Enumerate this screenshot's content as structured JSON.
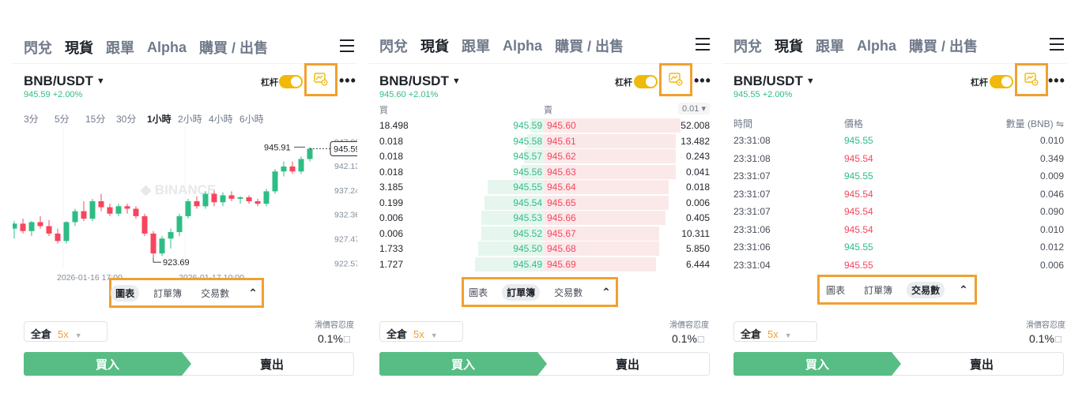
{
  "nav": {
    "items": [
      "閃兌",
      "現貨",
      "跟單",
      "Alpha",
      "購買 / 出售"
    ],
    "active": 1
  },
  "header": {
    "pair": "BNB/USDT",
    "caret": "▼",
    "leverage_label": "杠杆",
    "more": "•••"
  },
  "panels": [
    {
      "price": "945.59",
      "change": "+2.00%"
    },
    {
      "price": "945.60",
      "change": "+2.01%"
    },
    {
      "price": "945.55",
      "change": "+2.00%"
    }
  ],
  "tabs": {
    "chart": "圖表",
    "orderbook": "訂單簿",
    "trades": "交易數",
    "collapse": "⌃"
  },
  "timeframes": [
    "3分",
    "5分",
    "15分",
    "30分",
    "1小時",
    "2小時",
    "4小時",
    "6小時"
  ],
  "timeframe_active": 4,
  "chart_data": {
    "type": "candlestick",
    "y_ticks": [
      "947.03",
      "945.59",
      "942.13",
      "937.24",
      "932.36",
      "927.47",
      "922.57"
    ],
    "x_ticks": [
      "2026-01-16 17:00",
      "2026-01-17 10:00"
    ],
    "high_label": "945.91",
    "low_label": "923.69",
    "current_label": "945.59",
    "ylim": [
      921.5,
      948.5
    ],
    "candles": [
      {
        "o": 929.5,
        "h": 931.0,
        "l": 927.5,
        "c": 930.5
      },
      {
        "o": 930.5,
        "h": 931.5,
        "l": 928.5,
        "c": 929.0
      },
      {
        "o": 929.0,
        "h": 931.0,
        "l": 928.0,
        "c": 930.8
      },
      {
        "o": 930.8,
        "h": 932.0,
        "l": 929.5,
        "c": 930.0
      },
      {
        "o": 930.0,
        "h": 931.2,
        "l": 928.0,
        "c": 928.5
      },
      {
        "o": 928.5,
        "h": 929.5,
        "l": 926.5,
        "c": 927.0
      },
      {
        "o": 927.0,
        "h": 931.0,
        "l": 926.5,
        "c": 930.8
      },
      {
        "o": 930.8,
        "h": 933.5,
        "l": 930.0,
        "c": 933.0
      },
      {
        "o": 933.0,
        "h": 935.0,
        "l": 931.0,
        "c": 931.5
      },
      {
        "o": 931.5,
        "h": 935.5,
        "l": 931.0,
        "c": 935.0
      },
      {
        "o": 935.0,
        "h": 936.5,
        "l": 933.0,
        "c": 933.8
      },
      {
        "o": 933.8,
        "h": 934.5,
        "l": 932.0,
        "c": 932.5
      },
      {
        "o": 932.5,
        "h": 934.5,
        "l": 932.0,
        "c": 934.0
      },
      {
        "o": 934.0,
        "h": 934.5,
        "l": 932.5,
        "c": 933.5
      },
      {
        "o": 933.5,
        "h": 934.0,
        "l": 931.5,
        "c": 932.0
      },
      {
        "o": 932.0,
        "h": 932.5,
        "l": 928.0,
        "c": 928.5
      },
      {
        "o": 928.5,
        "h": 929.0,
        "l": 923.69,
        "c": 924.5
      },
      {
        "o": 924.5,
        "h": 928.0,
        "l": 924.0,
        "c": 927.5
      },
      {
        "o": 927.5,
        "h": 929.5,
        "l": 925.5,
        "c": 928.8
      },
      {
        "o": 928.8,
        "h": 932.5,
        "l": 928.0,
        "c": 932.0
      },
      {
        "o": 932.0,
        "h": 935.5,
        "l": 931.5,
        "c": 935.0
      },
      {
        "o": 935.0,
        "h": 936.0,
        "l": 933.5,
        "c": 934.0
      },
      {
        "o": 934.0,
        "h": 937.0,
        "l": 933.5,
        "c": 936.5
      },
      {
        "o": 936.5,
        "h": 937.2,
        "l": 934.0,
        "c": 934.8
      },
      {
        "o": 934.8,
        "h": 936.8,
        "l": 934.0,
        "c": 936.2
      },
      {
        "o": 936.2,
        "h": 937.0,
        "l": 935.0,
        "c": 935.5
      },
      {
        "o": 935.5,
        "h": 936.0,
        "l": 934.5,
        "c": 935.8
      },
      {
        "o": 935.8,
        "h": 936.2,
        "l": 934.5,
        "c": 935.0
      },
      {
        "o": 935.0,
        "h": 935.5,
        "l": 934.0,
        "c": 934.5
      },
      {
        "o": 934.5,
        "h": 937.5,
        "l": 934.0,
        "c": 937.0
      },
      {
        "o": 937.0,
        "h": 941.5,
        "l": 936.5,
        "c": 941.0
      },
      {
        "o": 941.0,
        "h": 943.0,
        "l": 940.0,
        "c": 942.0
      },
      {
        "o": 942.0,
        "h": 943.0,
        "l": 940.5,
        "c": 941.0
      },
      {
        "o": 941.0,
        "h": 944.0,
        "l": 940.5,
        "c": 943.5
      },
      {
        "o": 943.5,
        "h": 945.91,
        "l": 943.0,
        "c": 945.59
      }
    ]
  },
  "orderbook": {
    "buy_label": "買",
    "sell_label": "賣",
    "precision": "0.01 ▾",
    "rows": [
      {
        "bq": "18.498",
        "bp": "945.59",
        "sp": "945.60",
        "sq": "52.008",
        "bd": 0.08,
        "sd": 0.7
      },
      {
        "bq": "0.018",
        "bp": "945.58",
        "sp": "945.61",
        "sq": "13.482",
        "bd": 0.1,
        "sd": 0.73
      },
      {
        "bq": "0.018",
        "bp": "945.57",
        "sp": "945.62",
        "sq": "0.243",
        "bd": 0.12,
        "sd": 0.73
      },
      {
        "bq": "0.018",
        "bp": "945.56",
        "sp": "945.63",
        "sq": "0.041",
        "bd": 0.14,
        "sd": 0.73
      },
      {
        "bq": "3.185",
        "bp": "945.55",
        "sp": "945.64",
        "sq": "0.018",
        "bd": 0.34,
        "sd": 0.77
      },
      {
        "bq": "0.199",
        "bp": "945.54",
        "sp": "945.65",
        "sq": "0.006",
        "bd": 0.36,
        "sd": 0.77
      },
      {
        "bq": "0.006",
        "bp": "945.53",
        "sp": "945.66",
        "sq": "0.405",
        "bd": 0.38,
        "sd": 0.79
      },
      {
        "bq": "0.006",
        "bp": "945.52",
        "sp": "945.67",
        "sq": "10.311",
        "bd": 0.38,
        "sd": 0.83
      },
      {
        "bq": "1.733",
        "bp": "945.50",
        "sp": "945.68",
        "sq": "5.850",
        "bd": 0.4,
        "sd": 0.83
      },
      {
        "bq": "1.727",
        "bp": "945.49",
        "sp": "945.69",
        "sq": "6.444",
        "bd": 0.42,
        "sd": 0.85
      }
    ]
  },
  "trades": {
    "time_label": "時間",
    "price_label": "價格",
    "qty_label": "數量 (BNB) ⇋",
    "rows": [
      {
        "t": "23:31:08",
        "p": "945.55",
        "q": "0.010",
        "side": "g"
      },
      {
        "t": "23:31:08",
        "p": "945.54",
        "q": "0.349",
        "side": "r"
      },
      {
        "t": "23:31:07",
        "p": "945.55",
        "q": "0.009",
        "side": "g"
      },
      {
        "t": "23:31:07",
        "p": "945.54",
        "q": "0.046",
        "side": "r"
      },
      {
        "t": "23:31:07",
        "p": "945.54",
        "q": "0.090",
        "side": "r"
      },
      {
        "t": "23:31:06",
        "p": "945.54",
        "q": "0.010",
        "side": "r"
      },
      {
        "t": "23:31:06",
        "p": "945.55",
        "q": "0.012",
        "side": "g"
      },
      {
        "t": "23:31:04",
        "p": "945.55",
        "q": "0.006",
        "side": "r"
      }
    ]
  },
  "footer": {
    "margin_mode": "全倉",
    "leverage": "5x",
    "slippage_label": "滑價容忍度",
    "slippage_value": "0.1%",
    "buy": "買入",
    "sell": "賣出"
  },
  "colors": {
    "up": "#2ebd85",
    "down": "#f6465d",
    "accent": "#f0b90b",
    "highlight": "#f0a030"
  }
}
